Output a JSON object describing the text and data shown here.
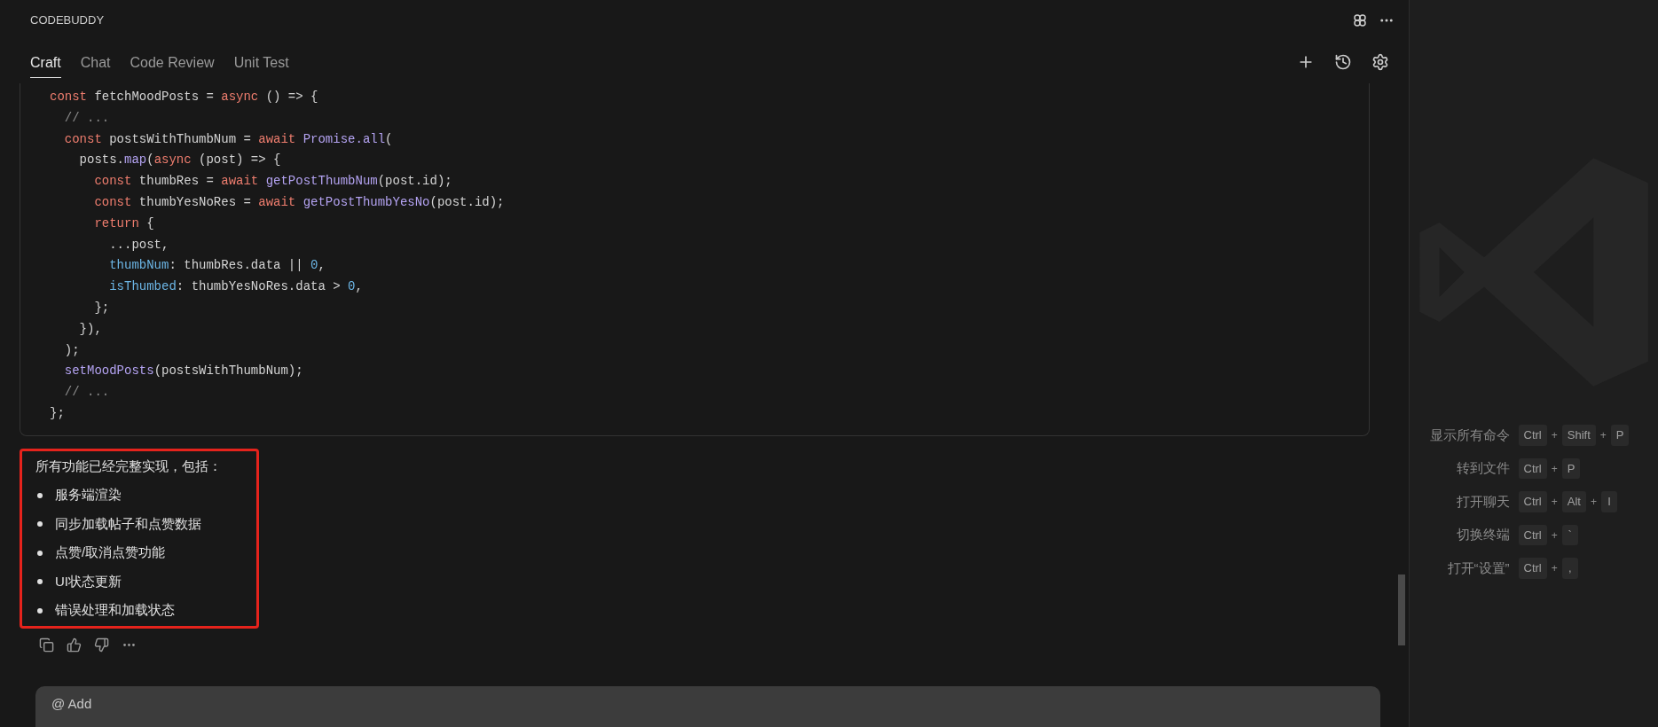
{
  "panel": {
    "title": "CODEBUDDY"
  },
  "tabs": [
    {
      "label": "Craft",
      "selected": true
    },
    {
      "label": "Chat",
      "selected": false
    },
    {
      "label": "Code Review",
      "selected": false
    },
    {
      "label": "Unit Test",
      "selected": false
    }
  ],
  "code_block": {
    "lines": [
      {
        "tokens": [
          {
            "kind": "keyword",
            "text": "const"
          },
          {
            "kind": "plain",
            "text": " fetchMoodPosts = "
          },
          {
            "kind": "keyword",
            "text": "async"
          },
          {
            "kind": "plain",
            "text": " () => {"
          }
        ]
      },
      {
        "tokens": [
          {
            "kind": "comment",
            "text": "  // ..."
          }
        ]
      },
      {
        "tokens": [
          {
            "kind": "keyword",
            "text": "  const"
          },
          {
            "kind": "plain",
            "text": " postsWithThumbNum = "
          },
          {
            "kind": "keyword",
            "text": "await"
          },
          {
            "kind": "function",
            "text": " Promise.all"
          },
          {
            "kind": "plain",
            "text": "("
          }
        ]
      },
      {
        "tokens": [
          {
            "kind": "plain",
            "text": "    posts."
          },
          {
            "kind": "function",
            "text": "map"
          },
          {
            "kind": "plain",
            "text": "("
          },
          {
            "kind": "keyword",
            "text": "async"
          },
          {
            "kind": "plain",
            "text": " (post) => {"
          }
        ]
      },
      {
        "tokens": [
          {
            "kind": "keyword",
            "text": "      const"
          },
          {
            "kind": "plain",
            "text": " thumbRes = "
          },
          {
            "kind": "keyword",
            "text": "await"
          },
          {
            "kind": "function",
            "text": " getPostThumbNum"
          },
          {
            "kind": "plain",
            "text": "(post.id);"
          }
        ]
      },
      {
        "tokens": [
          {
            "kind": "keyword",
            "text": "      const"
          },
          {
            "kind": "plain",
            "text": " thumbYesNoRes = "
          },
          {
            "kind": "keyword",
            "text": "await"
          },
          {
            "kind": "function",
            "text": " getPostThumbYesNo"
          },
          {
            "kind": "plain",
            "text": "(post.id);"
          }
        ]
      },
      {
        "tokens": [
          {
            "kind": "keyword",
            "text": "      return"
          },
          {
            "kind": "plain",
            "text": " {"
          }
        ]
      },
      {
        "tokens": [
          {
            "kind": "plain",
            "text": "        ...post,"
          }
        ]
      },
      {
        "tokens": [
          {
            "kind": "property",
            "text": "        thumbNum"
          },
          {
            "kind": "plain",
            "text": ": thumbRes.data || "
          },
          {
            "kind": "number",
            "text": "0"
          },
          {
            "kind": "plain",
            "text": ","
          }
        ]
      },
      {
        "tokens": [
          {
            "kind": "property",
            "text": "        isThumbed"
          },
          {
            "kind": "plain",
            "text": ": thumbYesNoRes.data > "
          },
          {
            "kind": "number",
            "text": "0"
          },
          {
            "kind": "plain",
            "text": ","
          }
        ]
      },
      {
        "tokens": [
          {
            "kind": "plain",
            "text": "      };"
          }
        ]
      },
      {
        "tokens": [
          {
            "kind": "plain",
            "text": "    }),"
          }
        ]
      },
      {
        "tokens": [
          {
            "kind": "plain",
            "text": "  );"
          }
        ]
      },
      {
        "tokens": [
          {
            "kind": "function",
            "text": "  setMoodPosts"
          },
          {
            "kind": "plain",
            "text": "(postsWithThumbNum);"
          }
        ]
      },
      {
        "tokens": [
          {
            "kind": "comment",
            "text": "  // ..."
          }
        ]
      },
      {
        "tokens": [
          {
            "kind": "plain",
            "text": "};"
          }
        ]
      }
    ]
  },
  "message": {
    "intro": "所有功能已经完整实现，包括：",
    "bullets": [
      "服务端渲染",
      "同步加载帖子和点赞数据",
      "点赞/取消点赞功能",
      "UI状态更新",
      "错误处理和加载状态"
    ]
  },
  "input": {
    "placeholder": "@ Add"
  },
  "shortcuts": [
    {
      "label": "显示所有命令",
      "keys": [
        {
          "kind": "key",
          "text": "Ctrl"
        },
        {
          "kind": "plus",
          "text": "+"
        },
        {
          "kind": "key",
          "text": "Shift"
        },
        {
          "kind": "plus",
          "text": "+"
        },
        {
          "kind": "key",
          "text": "P"
        }
      ]
    },
    {
      "label": "转到文件",
      "keys": [
        {
          "kind": "key",
          "text": "Ctrl"
        },
        {
          "kind": "plus",
          "text": "+"
        },
        {
          "kind": "key",
          "text": "P"
        }
      ]
    },
    {
      "label": "打开聊天",
      "keys": [
        {
          "kind": "key",
          "text": "Ctrl"
        },
        {
          "kind": "plus",
          "text": "+"
        },
        {
          "kind": "key",
          "text": "Alt"
        },
        {
          "kind": "plus",
          "text": "+"
        },
        {
          "kind": "key",
          "text": "I"
        }
      ]
    },
    {
      "label": "切换终端",
      "keys": [
        {
          "kind": "key",
          "text": "Ctrl"
        },
        {
          "kind": "plus",
          "text": "+"
        },
        {
          "kind": "key",
          "text": "`"
        }
      ]
    },
    {
      "label": "打开“设置”",
      "keys": [
        {
          "kind": "key",
          "text": "Ctrl"
        },
        {
          "kind": "plus",
          "text": "+"
        },
        {
          "kind": "key",
          "text": ","
        }
      ]
    }
  ]
}
